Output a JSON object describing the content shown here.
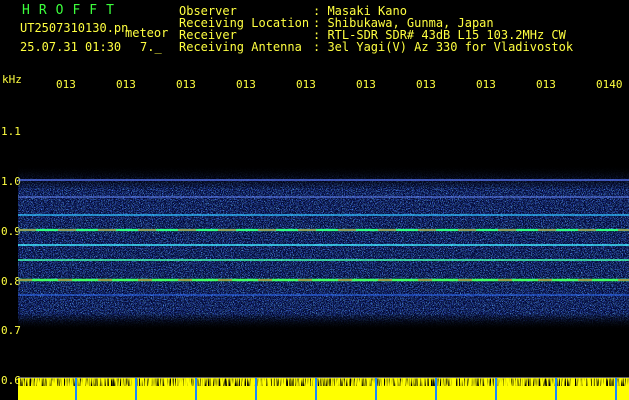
{
  "header": {
    "app_name": "HROFFT",
    "filename": "UT2507310130.pn",
    "meteor_label": "meteor",
    "datetime": "25.07.31 01:30",
    "count": "7._",
    "info": [
      {
        "label": "Observer",
        "value": ": Masaki Kano"
      },
      {
        "label": "Receiving Location",
        "value": ": Shibukawa, Gunma, Japan"
      },
      {
        "label": "Receiver",
        "value": ": RTL-SDR SDR# 43dB L15 103.2MHz CW"
      },
      {
        "label": "Receiving Antenna",
        "value": ": 3el Yagi(V) Az 330 for Vladivostok"
      }
    ]
  },
  "spectrogram": {
    "unit_label": "kHz",
    "time_ticks": [
      "013",
      "013",
      "013",
      "013",
      "013",
      "013",
      "013",
      "013",
      "013",
      "0140"
    ],
    "freq_ticks": [
      "1.1",
      "1.0",
      "0.9",
      "0.8",
      "0.7",
      "0.6"
    ],
    "colors": {
      "background": "#000000",
      "text": "#ffff40",
      "app_name": "#3cff3c",
      "noise_band": "#2040ff",
      "carrier": "#ff3030",
      "strip": "#ffff00",
      "gridline": "#ffffff"
    }
  }
}
